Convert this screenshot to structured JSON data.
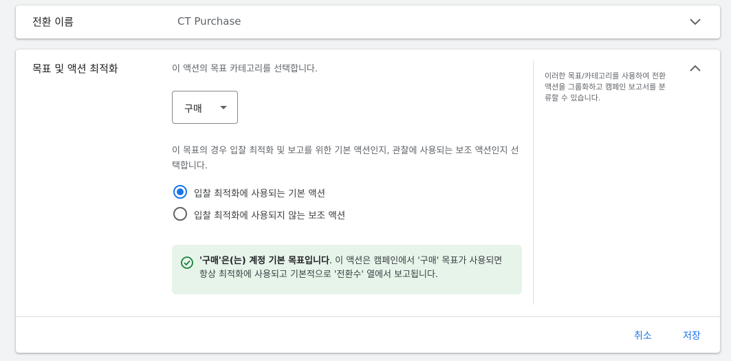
{
  "conversion_name": {
    "label": "전환 이름",
    "value": "CT Purchase"
  },
  "goal_section": {
    "title": "목표 및 액션 최적화",
    "category_description": "이 액션의 목표 카테고리를 선택합니다.",
    "category_select": {
      "selected": "구매"
    },
    "action_type_description": "이 목표의 경우 입찰 최적화 및 보고를 위한 기본 액션인지, 관찰에 사용되는 보조 액션인지 선택합니다.",
    "options": [
      {
        "label": "입찰 최적화에 사용되는 기본 액션",
        "checked": true
      },
      {
        "label": "입찰 최적화에 사용되지 않는 보조 액션",
        "checked": false
      }
    ],
    "notice": {
      "bold": "'구매'은(는) 계정 기본 목표입니다",
      "text": ". 이 액션은 캠페인에서 '구매' 목표가 사용되면 항상 최적화에 사용되고 기본적으로 '전환수' 열에서 보고됩니다."
    },
    "help_text": "이러한 목표/카테고리를 사용하여 전환 액션을 그룹화하고 캠페인 보고서를 분류할 수 있습니다."
  },
  "actions": {
    "cancel": "취소",
    "save": "저장"
  },
  "colors": {
    "accent": "#1a73e8",
    "notice_bg": "#e6f4ea",
    "success": "#188038"
  },
  "icons": {
    "expand": "chevron-down-icon",
    "collapse": "chevron-up-icon",
    "dropdown": "arrow-drop-down-icon",
    "notice": "check-circle-icon"
  }
}
